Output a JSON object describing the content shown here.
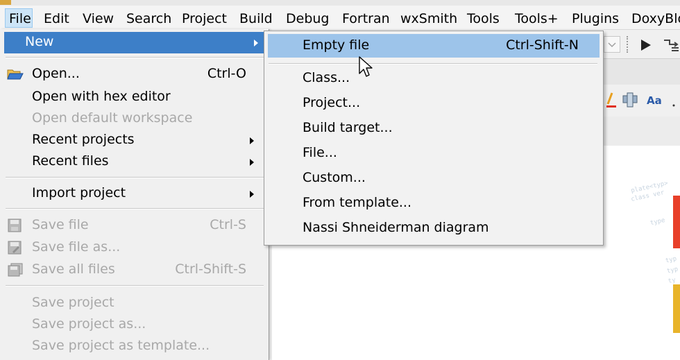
{
  "menubar": {
    "items": [
      "File",
      "Edit",
      "View",
      "Search",
      "Project",
      "Build",
      "Debug",
      "Fortran",
      "wxSmith",
      "Tools",
      "Tools+",
      "Plugins",
      "DoxyBlo"
    ]
  },
  "file_menu": {
    "new": "New",
    "open": {
      "label": "Open...",
      "shortcut": "Ctrl-O"
    },
    "open_hex": "Open with hex editor",
    "open_workspace": "Open default workspace",
    "recent_projects": "Recent projects",
    "recent_files": "Recent files",
    "import_project": "Import project",
    "save_file": {
      "label": "Save file",
      "shortcut": "Ctrl-S"
    },
    "save_file_as": "Save file as...",
    "save_all": {
      "label": "Save all files",
      "shortcut": "Ctrl-Shift-S"
    },
    "save_project": "Save project",
    "save_project_as": "Save project as...",
    "save_project_template": "Save project as template..."
  },
  "new_submenu": {
    "empty_file": {
      "label": "Empty file",
      "shortcut": "Ctrl-Shift-N"
    },
    "class": "Class...",
    "project": "Project...",
    "build_target": "Build target...",
    "file": "File...",
    "custom": "Custom...",
    "from_template": "From template...",
    "nassi": "Nassi Shneiderman diagram"
  },
  "colors": {
    "highlight_blue": "#3d7fc8",
    "hover_light_blue": "#9dc4ea",
    "disabled_gray": "#a8a8a8"
  }
}
